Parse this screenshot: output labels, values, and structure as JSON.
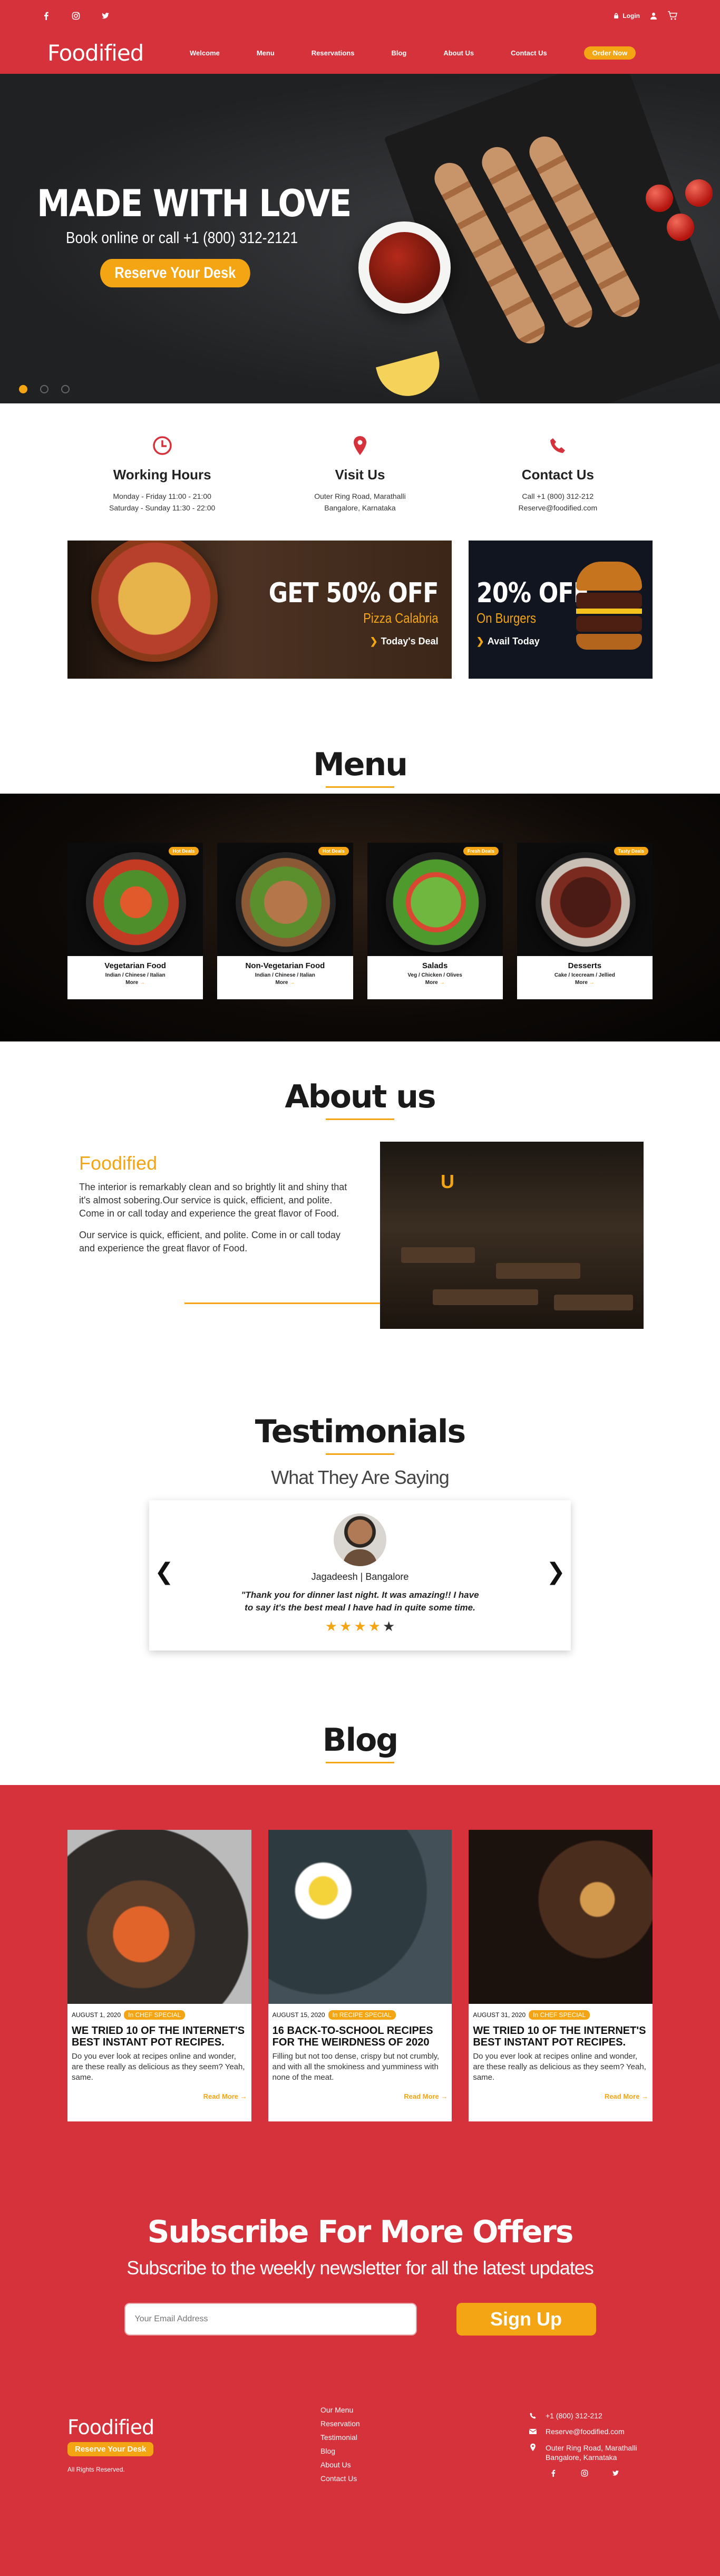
{
  "header": {
    "logo": "Foodified",
    "nav": [
      "Welcome",
      "Menu",
      "Reservations",
      "Blog",
      "About Us",
      "Contact Us"
    ],
    "order_button": "Order Now",
    "login": "Login"
  },
  "hero": {
    "title": "MADE WITH LOVE",
    "subtitle": "Book online or call +1 (800) 312-2121",
    "button": "Reserve Your Desk"
  },
  "info": [
    {
      "title": "Working Hours",
      "lines": [
        "Monday - Friday 11:00 - 21:00",
        "Saturday - Sunday 11:30 - 22:00"
      ]
    },
    {
      "title": "Visit Us",
      "lines": [
        "Outer Ring Road, Marathalli",
        "Bangalore, Karnataka"
      ]
    },
    {
      "title": "Contact Us",
      "lines": [
        "Call +1 (800) 312-212",
        "Reserve@foodified.com"
      ]
    }
  ],
  "offers": [
    {
      "big": "GET 50% OFF",
      "name": "Pizza Calabria",
      "link": "Today's Deal"
    },
    {
      "big": "20% OFF",
      "name": "On Burgers",
      "link": "Avail Today"
    }
  ],
  "menu": {
    "title": "Menu",
    "items": [
      {
        "badge": "Hot Deals",
        "name": "Vegetarian Food",
        "sub": "Indian / Chinese / Italian",
        "more": "More"
      },
      {
        "badge": "Hot Deals",
        "name": "Non-Vegetarian Food",
        "sub": "Indian / Chinese / Italian",
        "more": "More"
      },
      {
        "badge": "Fresh Deals",
        "name": "Salads",
        "sub": "Veg / Chicken / Olives",
        "more": "More"
      },
      {
        "badge": "Tasty Deals",
        "name": "Desserts",
        "sub": "Cake / Icecream / Jellied",
        "more": "More"
      }
    ]
  },
  "about": {
    "title": "About us",
    "brand": "Foodified",
    "p1": "The interior is remarkably clean and so brightly lit and shiny that it's almost sobering.Our service is quick, efficient, and polite. Come in or call today and experience the great flavor of Food.",
    "p2": "Our service is quick, efficient, and polite. Come in or call today and experience the great flavor of Food."
  },
  "testimonials": {
    "title": "Testimonials",
    "subtitle": "What They Are Saying",
    "name": "Jagadeesh | Bangalore",
    "quote": "\"Thank you for dinner last night. It was amazing!! I have to say it's the best meal I have had in quite some time.",
    "rating": 4.5
  },
  "blog": {
    "title": "Blog",
    "posts": [
      {
        "date": "AUGUST 1, 2020",
        "tag": "In CHEF SPECIAL",
        "title": "WE TRIED 10 OF THE INTERNET'S BEST INSTANT POT RECIPES.",
        "excerpt": "Do you ever look at recipes online and wonder, are these really as delicious as they seem? Yeah, same.",
        "more": "Read More"
      },
      {
        "date": "AUGUST 15, 2020",
        "tag": "In RECIPE SPECIAL",
        "title": "16 BACK-TO-SCHOOL RECIPES FOR THE WEIRDNESS OF 2020",
        "excerpt": "Filling but not too dense, crispy but not crumbly, and with all the smokiness and yumminess with none of the meat.",
        "more": "Read More"
      },
      {
        "date": "AUGUST 31, 2020",
        "tag": "In CHEF SPECIAL",
        "title": "WE TRIED 10 OF THE INTERNET'S BEST INSTANT POT RECIPES.",
        "excerpt": "Do you ever look at recipes online and wonder, are these really as delicious as they seem? Yeah, same.",
        "more": "Read More"
      }
    ]
  },
  "subscribe": {
    "title": "Subscribe For More Offers",
    "subtitle": "Subscribe to the weekly newsletter for all the latest updates",
    "placeholder": "Your Email Address",
    "button": "Sign Up"
  },
  "footer": {
    "logo": "Foodified",
    "button": "Reserve Your Desk",
    "rights": "All Rights Reserved.",
    "links": [
      "Our Menu",
      "Reservation",
      "Testimonial",
      "Blog",
      "About Us",
      "Contact Us"
    ],
    "phone": "+1 (800) 312-212",
    "email": "Reserve@foodified.com",
    "address": "Outer Ring Road, Marathalli Bangalore, Karnataka"
  },
  "colors": {
    "brand_red": "#d6323c",
    "accent_orange": "#f4a514"
  }
}
